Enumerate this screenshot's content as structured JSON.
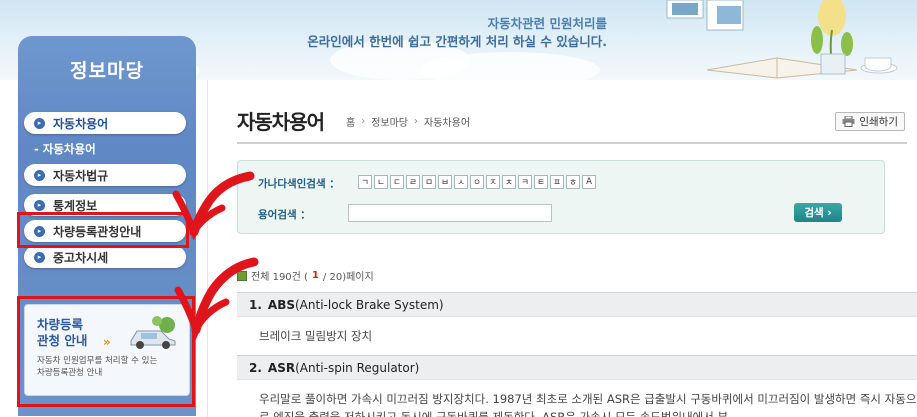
{
  "banner": {
    "line1": "자동차관련 민원처리를",
    "line2": "온라인에서 한번에 쉽고 간편하게 처리 하실 수 있습니다."
  },
  "sidebar": {
    "title": "정보마당",
    "items": [
      {
        "label": "자동차용어",
        "active": true
      },
      {
        "label": "자동차법규"
      },
      {
        "label": "통계정보"
      },
      {
        "label": "차량등록관청안내"
      },
      {
        "label": "중고차시세"
      }
    ],
    "sub_item": "- 자동차용어",
    "promo": {
      "title_line1": "차량등록",
      "title_line2": "관청 안내",
      "arrow": "»",
      "desc_line1": "자동차 민원업무를 처리할 수 있는",
      "desc_line2": "차량등록관청 안내"
    }
  },
  "header": {
    "title": "자동차용어",
    "breadcrumb": [
      "홈",
      "정보마당",
      "자동차용어"
    ],
    "print_label": "인쇄하기"
  },
  "search": {
    "index_label": "가나다색인검색 ：",
    "index_chars": [
      "ㄱ",
      "ㄴ",
      "ㄷ",
      "ㄹ",
      "ㅁ",
      "ㅂ",
      "ㅅ",
      "ㅇ",
      "ㅈ",
      "ㅊ",
      "ㅋ",
      "ㅌ",
      "ㅍ",
      "ㅎ",
      "A"
    ],
    "term_label": "용어검색 ：",
    "term_value": "",
    "button_label": "검색 ›"
  },
  "results": {
    "prefix": "전체 190건 (",
    "current_page": "1",
    "suffix": " / 20)페이지",
    "entries": [
      {
        "num": "1.",
        "abbr": "ABS",
        "full": "(Anti-lock Brake System)",
        "definition": "브레이크 밀림방지 장치"
      },
      {
        "num": "2.",
        "abbr": "ASR",
        "full": "(Anti-spin Regulator)",
        "definition": "우리말로 풀이하면 가속시 미끄러짐 방지장치다. 1987년 최초로 소개된 ASR은 급출발시 구동바퀴에서 미끄러짐이 발생하면 즉시 자동으로 엔진을 출력을 저하시키고 동시에 구동바퀴를 제동한다. ASR은 가속시 모든 속도범위내에서 부"
      }
    ]
  },
  "colors": {
    "sidebar": "#6b92c9",
    "highlight": "#e0141b",
    "accent": "#1f8585"
  }
}
